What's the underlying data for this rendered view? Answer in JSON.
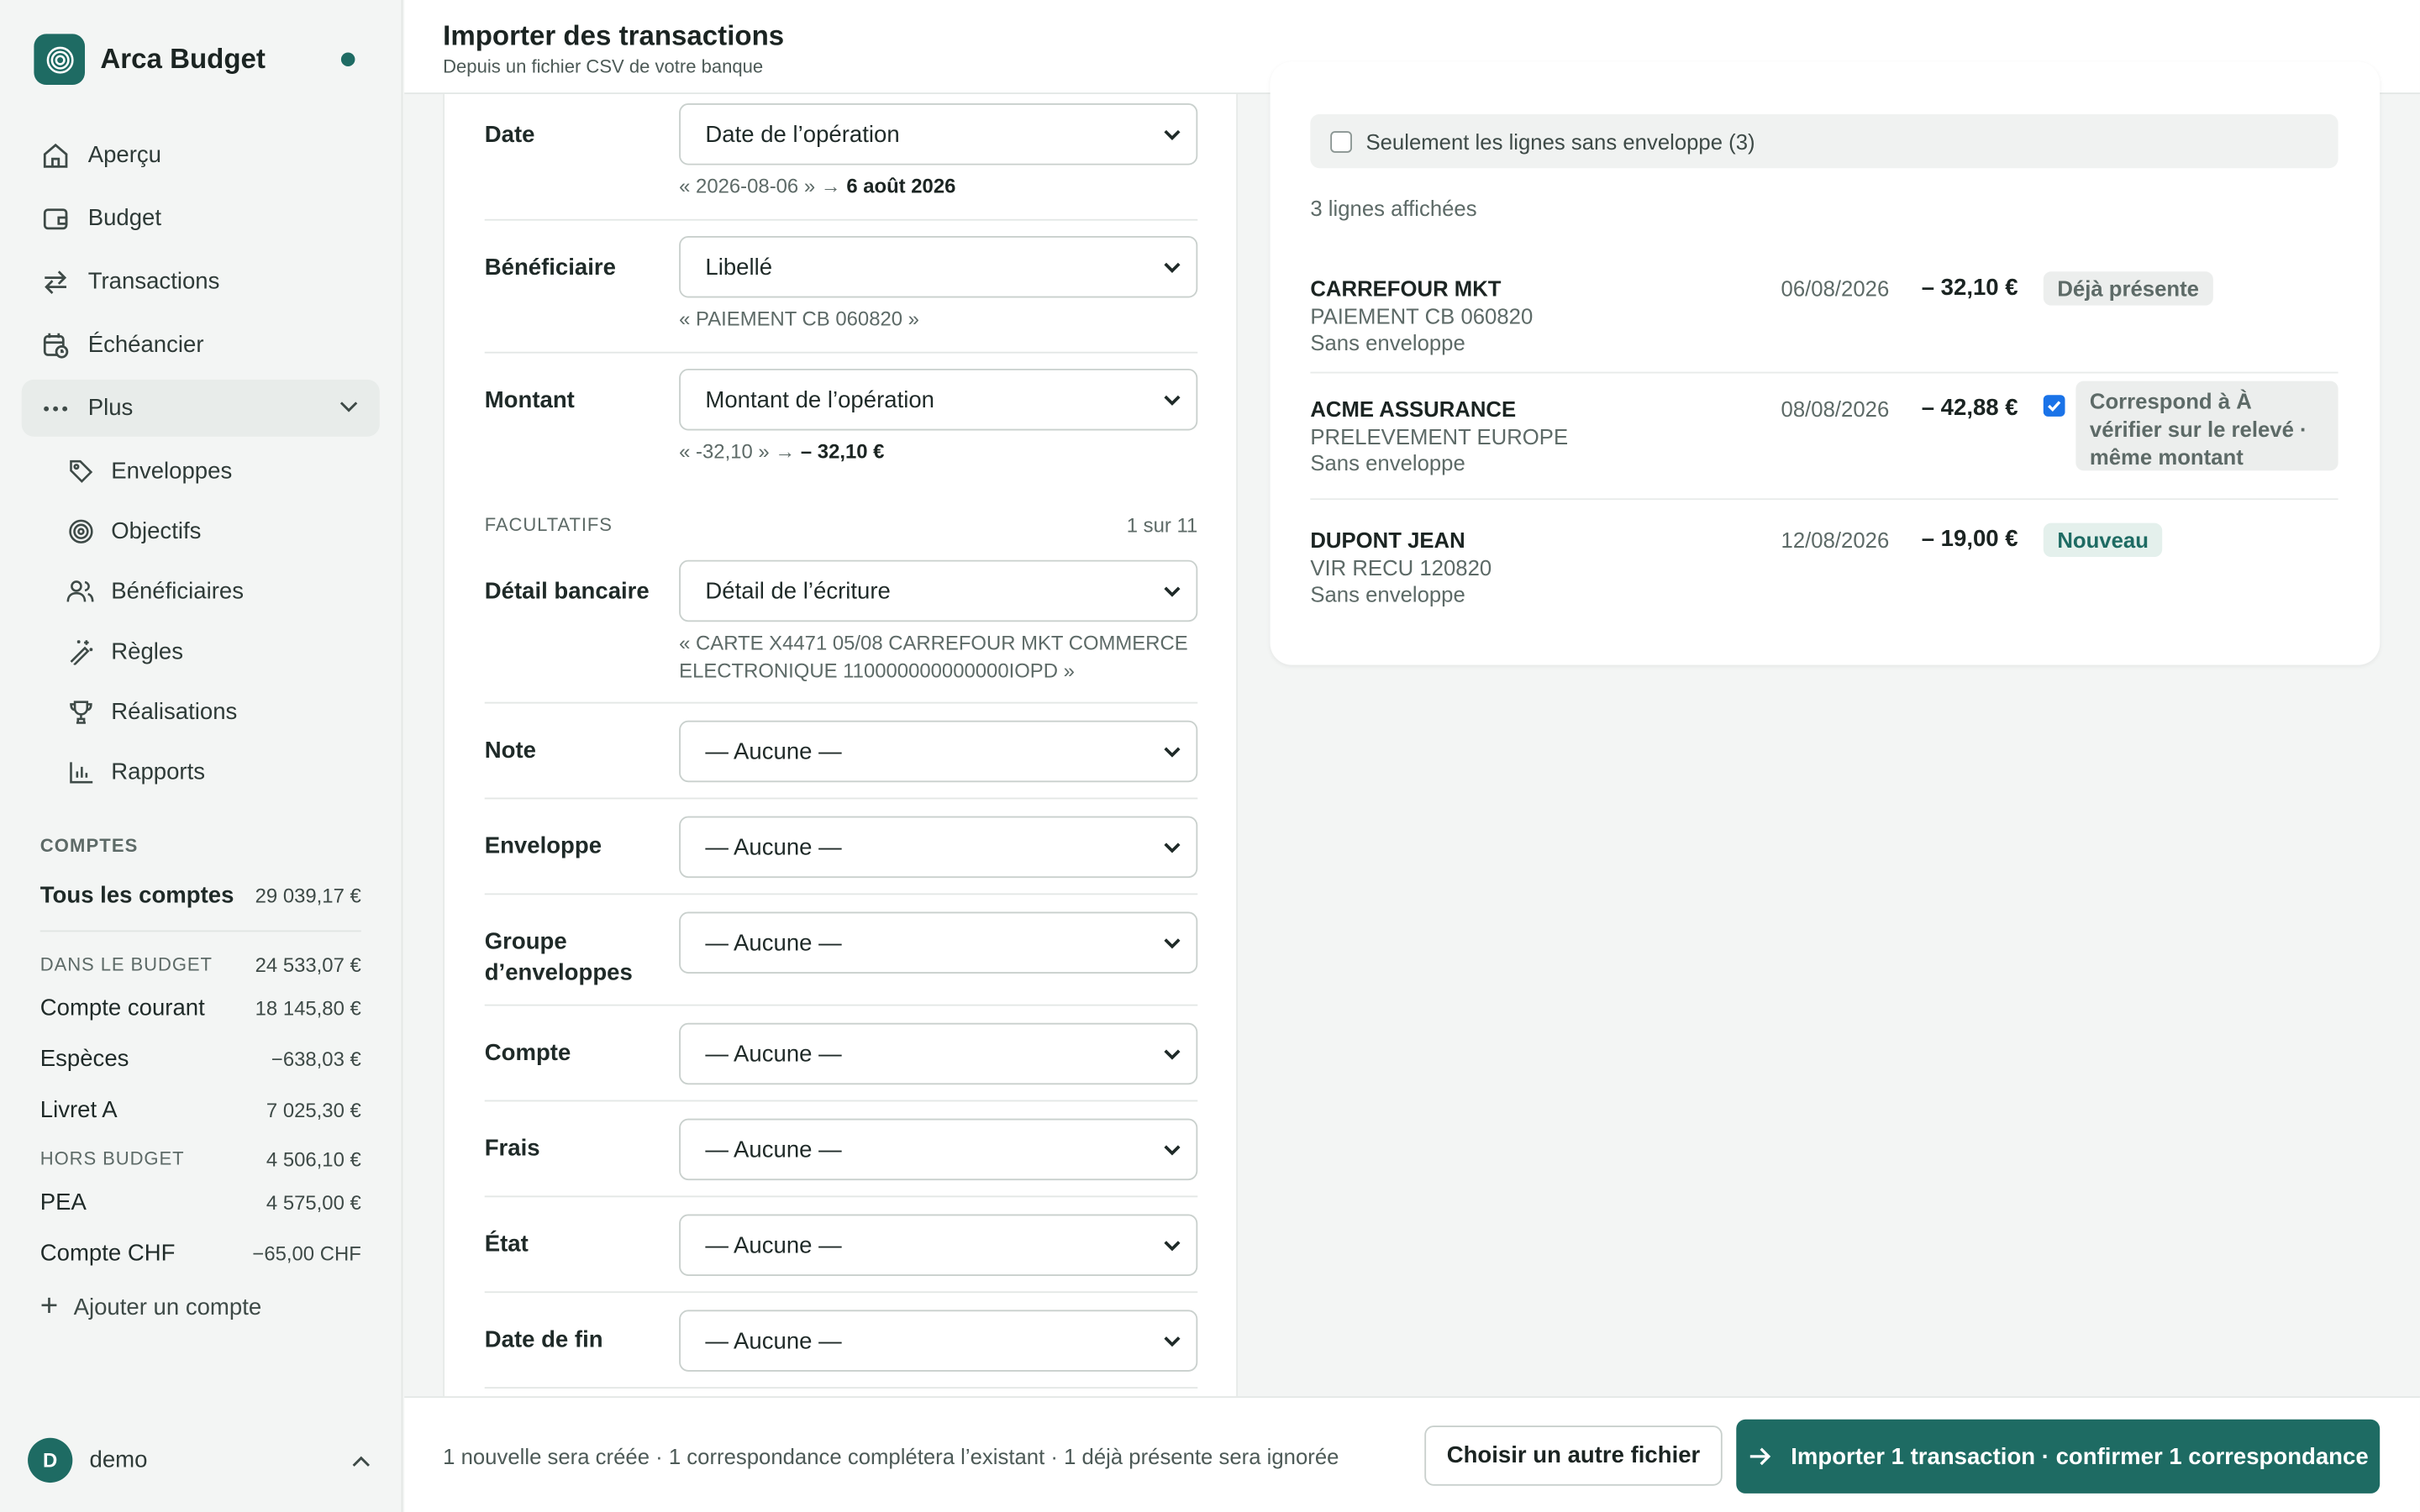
{
  "app": {
    "name": "Arca Budget"
  },
  "nav": {
    "items": [
      {
        "label": "Aperçu"
      },
      {
        "label": "Budget"
      },
      {
        "label": "Transactions"
      },
      {
        "label": "Échéancier"
      },
      {
        "label": "Plus"
      }
    ],
    "sub_items": [
      {
        "label": "Enveloppes"
      },
      {
        "label": "Objectifs"
      },
      {
        "label": "Bénéficiaires"
      },
      {
        "label": "Règles"
      },
      {
        "label": "Réalisations"
      },
      {
        "label": "Rapports"
      }
    ]
  },
  "accounts": {
    "section_label": "COMPTES",
    "all": {
      "label": "Tous les comptes",
      "amount": "29 039,17 €"
    },
    "in_budget": {
      "label": "DANS LE BUDGET",
      "amount": "24 533,07 €",
      "items": [
        {
          "name": "Compte courant",
          "amount": "18 145,80 €"
        },
        {
          "name": "Espèces",
          "amount": "−638,03 €"
        },
        {
          "name": "Livret A",
          "amount": "7 025,30 €"
        }
      ]
    },
    "off_budget": {
      "label": "HORS BUDGET",
      "amount": "4 506,10 €",
      "items": [
        {
          "name": "PEA",
          "amount": "4 575,00 €"
        },
        {
          "name": "Compte CHF",
          "amount": "−65,00 CHF"
        }
      ]
    },
    "add_label": "Ajouter un compte"
  },
  "user": {
    "initial": "D",
    "name": "demo"
  },
  "header": {
    "title": "Importer des transactions",
    "subtitle": "Depuis un fichier CSV de votre banque"
  },
  "mapping": {
    "required": [
      {
        "label": "Date",
        "value": "Date de l’opération",
        "preview_raw": "« 2026-08-06 »",
        "preview_arrow": "→",
        "preview_parsed": "6 août 2026"
      },
      {
        "label": "Bénéficiaire",
        "value": "Libellé",
        "preview_raw": "« PAIEMENT CB 060820 »"
      },
      {
        "label": "Montant",
        "value": "Montant de l’opération",
        "preview_raw": "« -32,10 »",
        "preview_arrow": "→",
        "preview_parsed": "– 32,10 €"
      }
    ],
    "optional_label": "FACULTATIFS",
    "optional_count": "1 sur 11",
    "optional": [
      {
        "label": "Détail bancaire",
        "value": "Détail de l’écriture",
        "preview_raw": "« CARTE X4471 05/08 CARREFOUR MKT COMMERCE ELECTRONIQUE 110000000000000IOPD »"
      },
      {
        "label": "Note",
        "value": "— Aucune —"
      },
      {
        "label": "Enveloppe",
        "value": "— Aucune —"
      },
      {
        "label": "Groupe d’enveloppes",
        "value": "— Aucune —"
      },
      {
        "label": "Compte",
        "value": "— Aucune —"
      },
      {
        "label": "Frais",
        "value": "— Aucune —"
      },
      {
        "label": "État",
        "value": "— Aucune —"
      },
      {
        "label": "Date de fin",
        "value": "— Aucune —"
      }
    ]
  },
  "preview": {
    "filter_label": "Seulement les lignes sans enveloppe (3)",
    "count_label": "3 lignes affichées",
    "rows": [
      {
        "payee": "CARREFOUR MKT",
        "memo": "PAIEMENT CB 060820",
        "envelope": "Sans enveloppe",
        "date": "06/08/2026",
        "amount": "– 32,10 €",
        "status": "Déjà présente"
      },
      {
        "payee": "ACME ASSURANCE",
        "memo": "PRELEVEMENT EUROPE",
        "envelope": "Sans enveloppe",
        "date": "08/08/2026",
        "amount": "– 42,88 €",
        "status": "Correspond à À vérifier sur le relevé · même montant"
      },
      {
        "payee": "DUPONT JEAN",
        "memo": "VIR RECU 120820",
        "envelope": "Sans enveloppe",
        "date": "12/08/2026",
        "amount": "– 19,00 €",
        "status": "Nouveau"
      }
    ]
  },
  "footer": {
    "summary": "1 nouvelle sera créée · 1 correspondance complétera l’existant · 1 déjà présente sera ignorée",
    "secondary_label": "Choisir un autre fichier",
    "primary_label": "Importer 1 transaction · confirmer 1 correspondance"
  },
  "colors": {
    "accent": "#1e6b63",
    "checkbox": "#1a73e8"
  }
}
